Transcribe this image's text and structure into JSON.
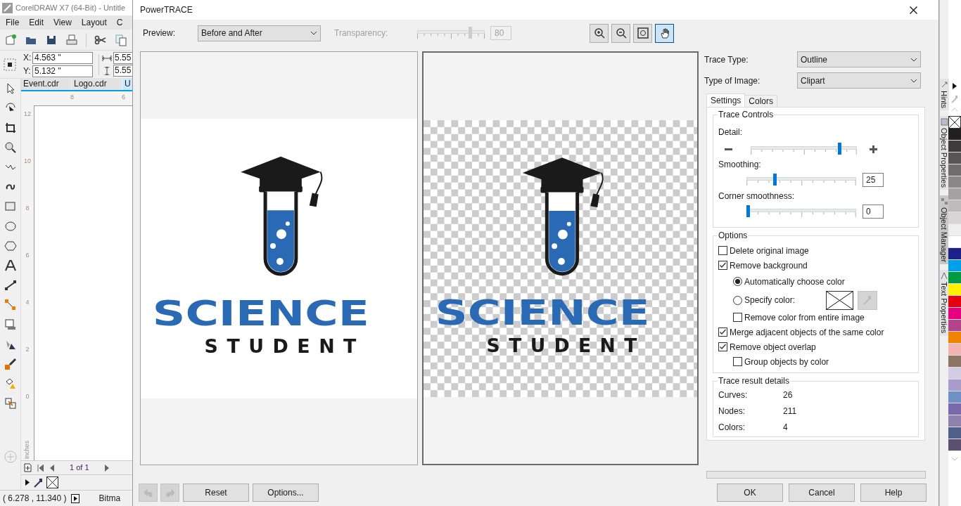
{
  "app": {
    "title": "CorelDRAW X7 (64-Bit) - Untitle",
    "menu": [
      "File",
      "Edit",
      "View",
      "Layout",
      "C"
    ],
    "position": {
      "x_label": "X:",
      "x": "4.563 \"",
      "y_label": "Y:",
      "y": "5.132 \""
    },
    "size": [
      "5.55",
      "5.55"
    ],
    "doc_tabs": [
      {
        "label": "Event.cdr",
        "selected": false
      },
      {
        "label": "Logo.cdr",
        "selected": false
      },
      {
        "label": "U",
        "selected": true
      }
    ],
    "ruler_h": [
      "8",
      "6"
    ],
    "ruler_v": [
      "12",
      "10",
      "8",
      "6",
      "4",
      "2",
      "0"
    ],
    "ruler_unit": "inches",
    "page_nav": "1 of 1",
    "status_coords": "( 6.278 , 11.340 )",
    "status_text": "Bitma"
  },
  "dialog": {
    "title": "PowerTRACE",
    "preview_label": "Preview:",
    "preview_mode": "Before and After",
    "transparency": {
      "label": "Transparency:",
      "level": 0.8,
      "value": "80",
      "disabled": true
    },
    "view_tools": [
      {
        "kind": "zoom-in",
        "selected": false
      },
      {
        "kind": "zoom-out",
        "selected": false
      },
      {
        "kind": "fit",
        "selected": false
      },
      {
        "kind": "pan",
        "selected": true
      }
    ],
    "before_image": {
      "title": "SCIENCE",
      "subtitle": "STUDENT"
    },
    "after_image": {
      "title": "SCIENCE",
      "subtitle": "STUDENT"
    },
    "trace_type_label": "Trace Type:",
    "trace_type": "Outline",
    "image_type_label": "Type of Image:",
    "image_type": "Clipart",
    "tabs": [
      {
        "label": "Settings",
        "selected": true
      },
      {
        "label": "Colors",
        "selected": false
      }
    ],
    "trace_controls": {
      "title": "Trace Controls",
      "sliders": [
        {
          "kind": "plus-minus",
          "label": "Detail:",
          "level": 0.85
        },
        {
          "kind": "value",
          "label": "Smoothing:",
          "level": 0.25,
          "value": "25"
        },
        {
          "kind": "value",
          "label": "Corner smoothness:",
          "level": 0,
          "value": "0"
        }
      ]
    },
    "options": {
      "title": "Options",
      "items": [
        {
          "kind": "checkbox",
          "label": "Delete original image",
          "checked": false
        },
        {
          "kind": "checkbox",
          "label": "Remove background",
          "checked": true,
          "children": [
            {
              "kind": "radio",
              "label": "Automatically choose color",
              "selected": true
            },
            {
              "kind": "color-radio",
              "label": "Specify color:",
              "selected": false
            },
            {
              "kind": "checkbox",
              "label": "Remove color from entire image",
              "checked": false
            }
          ]
        },
        {
          "kind": "checkbox",
          "label": "Merge adjacent objects of the same color",
          "checked": true
        },
        {
          "kind": "checkbox",
          "label": "Remove object overlap",
          "checked": true,
          "children": [
            {
              "kind": "checkbox",
              "label": "Group objects by color",
              "checked": false
            }
          ]
        }
      ]
    },
    "results": {
      "title": "Trace result details",
      "rows": [
        {
          "label": "Curves:",
          "value": "26"
        },
        {
          "label": "Nodes:",
          "value": "211"
        },
        {
          "label": "Colors:",
          "value": "4"
        }
      ]
    },
    "progress": {
      "level": 0
    },
    "left_buttons": [
      "Reset",
      "Options..."
    ],
    "right_buttons": [
      "OK",
      "Cancel",
      "Help"
    ]
  },
  "dockers": [
    {
      "label": "Hints",
      "selected": false
    },
    {
      "label": "Object Properties",
      "selected": false
    },
    {
      "label": "Object Manager",
      "selected": true
    },
    {
      "label": "Text Properties",
      "selected": false
    }
  ],
  "palette": [
    {
      "color": "#231f20"
    },
    {
      "color": "#3e3a3b"
    },
    {
      "color": "#575455"
    },
    {
      "color": "#706d6e"
    },
    {
      "color": "#8a8788"
    },
    {
      "color": "#a4a1a2"
    },
    {
      "color": "#bebbbc"
    },
    {
      "color": "#d7d5d6"
    },
    {
      "color": "#efeeee"
    },
    {
      "color": "#ffffff"
    },
    {
      "color": "#1d2088"
    },
    {
      "color": "#00a0e9"
    },
    {
      "color": "#009944"
    },
    {
      "color": "#fff100"
    },
    {
      "color": "#e60012"
    },
    {
      "color": "#e4007f"
    },
    {
      "color": "#b5428a"
    },
    {
      "color": "#f08300"
    },
    {
      "color": "#f4b3b3"
    },
    {
      "color": "#8c7565"
    },
    {
      "color": "#d1cde4"
    },
    {
      "color": "#a89ccb"
    },
    {
      "color": "#7091c8"
    },
    {
      "color": "#7a68ad"
    },
    {
      "color": "#8f81ae"
    },
    {
      "color": "#4f5f8a"
    },
    {
      "color": "#5c5070"
    }
  ]
}
